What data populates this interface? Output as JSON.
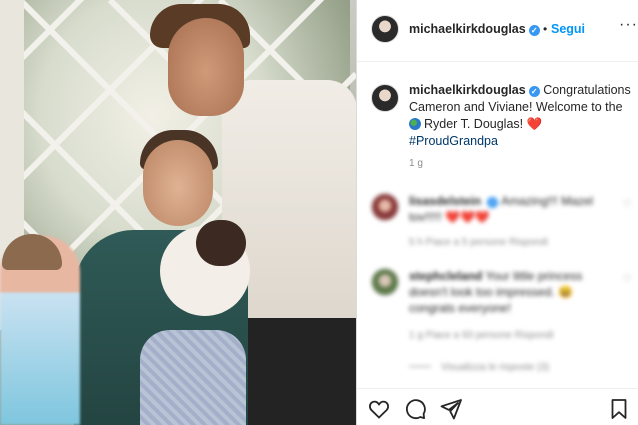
{
  "post": {
    "username": "michaelkirkdouglas",
    "follow_label": "Segui",
    "separator": "•",
    "more_icon": "more-icon"
  },
  "caption": {
    "username": "michaelkirkdouglas",
    "text_1": "Congratulations Cameron and Viviane! Welcome to the",
    "text_2": "Ryder T. Douglas!",
    "heart": "❤️",
    "hashtag": "#ProudGrandpa",
    "time": "1 g"
  },
  "comments": [
    {
      "username": "lisasdelstein",
      "text": "Amazing!!! Mazel tov!!!!!",
      "hearts": "❤️❤️❤️",
      "meta": "5 h   Piace a 5 persone   Rispondi"
    },
    {
      "username": "stephcleland",
      "text": "Your little princess doesn't look too impressed. 😆 congrats everyone!",
      "meta": "1 g   Piace a 93 persone   Rispondi",
      "view_replies": "Visualizza le risposte (3)"
    }
  ],
  "colors": {
    "link": "#0095f6",
    "verified": "#3897f0",
    "hashtag": "#00376b",
    "heart": "#ed4956",
    "muted": "#8e8e8e"
  },
  "actions": [
    "heart-icon",
    "comment-icon",
    "share-icon",
    "bookmark-icon"
  ]
}
